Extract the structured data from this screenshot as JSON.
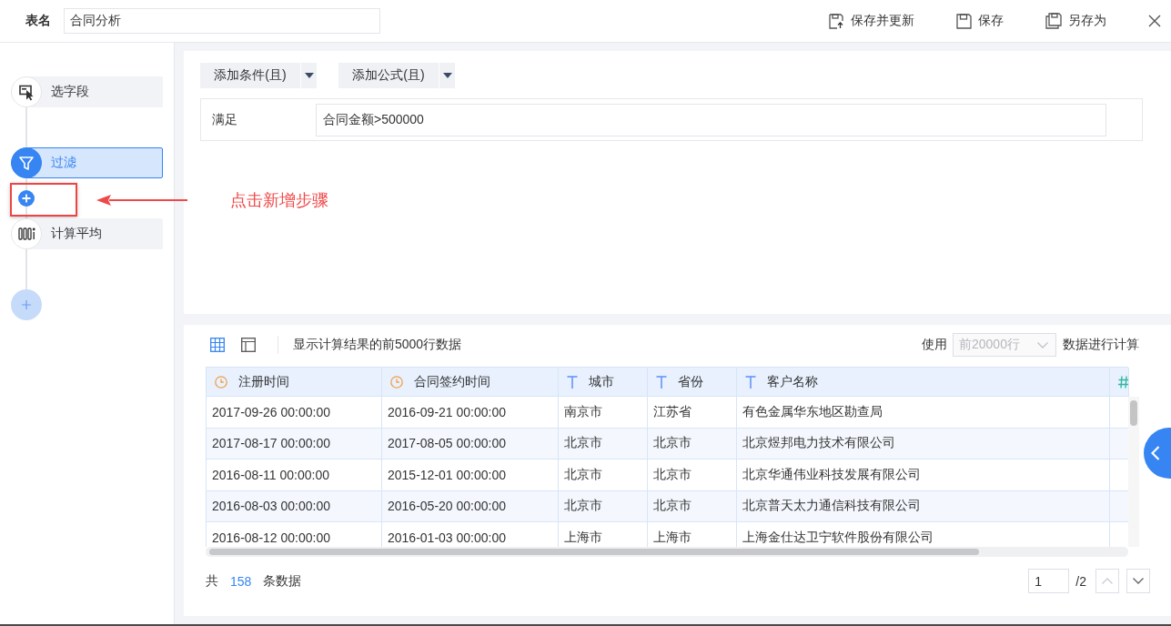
{
  "header": {
    "name_label": "表名",
    "name_value": "合同分析",
    "actions": [
      {
        "kind": "save_update",
        "label": "保存并更新"
      },
      {
        "kind": "save",
        "label": "保存"
      },
      {
        "kind": "save_as",
        "label": "另存为"
      }
    ]
  },
  "steps": [
    {
      "kind": "fields",
      "label": "选字段",
      "selected": false,
      "insert_button": false
    },
    {
      "kind": "filter",
      "label": "过滤",
      "selected": true,
      "insert_button": true
    },
    {
      "kind": "average",
      "label": "计算平均",
      "selected": false,
      "insert_button": false
    }
  ],
  "annotation": {
    "text": "点击新增步骤"
  },
  "filter": {
    "buttons": [
      {
        "label": "添加条件(且)"
      },
      {
        "label": "添加公式(且)"
      }
    ],
    "condition": {
      "label": "满足",
      "value": "合同金额>500000"
    }
  },
  "preview": {
    "view_modes": [
      {
        "kind": "grid",
        "selected": true
      },
      {
        "kind": "panel",
        "selected": false
      }
    ],
    "info": "显示计算结果的前5000行数据",
    "limit_prefix": "使用",
    "limit_select": {
      "value": "前20000行",
      "disabled": true
    },
    "limit_suffix": "数据进行计算"
  },
  "table": {
    "columns": [
      {
        "kind": "time",
        "label": "注册时间"
      },
      {
        "kind": "time",
        "label": "合同签约时间"
      },
      {
        "kind": "text",
        "label": "城市"
      },
      {
        "kind": "text",
        "label": "省份"
      },
      {
        "kind": "text",
        "label": "客户名称"
      },
      {
        "kind": "number"
      }
    ],
    "rows": [
      [
        "2017-09-26 00:00:00",
        "2016-09-21 00:00:00",
        "南京市",
        "江苏省",
        "有色金属华东地区勘查局"
      ],
      [
        "2017-08-17 00:00:00",
        "2017-08-05 00:00:00",
        "北京市",
        "北京市",
        "北京煜邦电力技术有限公司"
      ],
      [
        "2016-08-11 00:00:00",
        "2015-12-01 00:00:00",
        "北京市",
        "北京市",
        "北京华通伟业科技发展有限公司"
      ],
      [
        "2016-08-03 00:00:00",
        "2016-05-20 00:00:00",
        "北京市",
        "北京市",
        "北京普天太力通信科技有限公司"
      ],
      [
        "2016-08-12 00:00:00",
        "2016-01-03 00:00:00",
        "上海市",
        "上海市",
        "上海金仕达卫宁软件股份有限公司"
      ]
    ]
  },
  "footer": {
    "total_prefix": "共",
    "total": "158",
    "total_suffix": "条数据",
    "page": "1",
    "page_count": "/2",
    "prev_disabled": true,
    "next_disabled": false
  }
}
